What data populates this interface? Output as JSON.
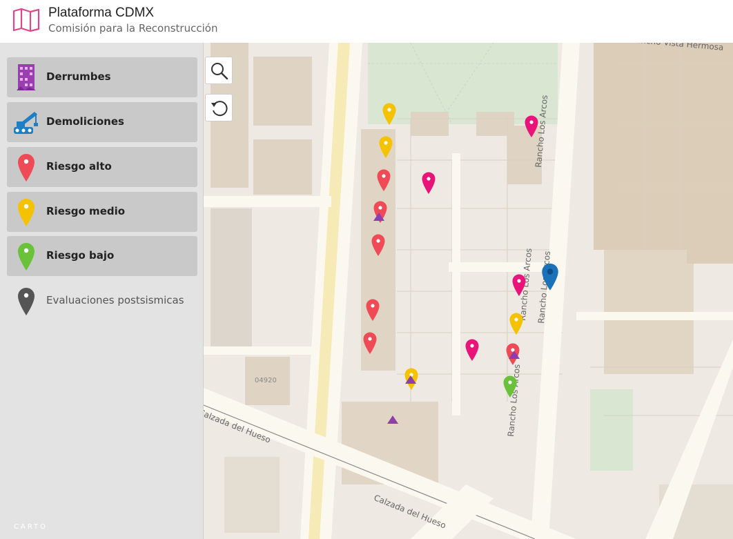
{
  "header": {
    "title": "Plataforma CDMX",
    "subtitle": "Comisión para la Reconstrucción",
    "logo_icon": "map-fold-icon",
    "logo_color": "#e0468a"
  },
  "legend": [
    {
      "key": "derrumbes",
      "label": "Derrumbes",
      "icon": "collapsed-building-icon",
      "color": "#9b3fb0",
      "active": true
    },
    {
      "key": "demoliciones",
      "label": "Demoliciones",
      "icon": "crane-icon",
      "color": "#1f7fc4",
      "active": true
    },
    {
      "key": "riesgo_alto",
      "label": "Riesgo alto",
      "icon": "map-pin-icon",
      "color": "#ef4b57",
      "active": true
    },
    {
      "key": "riesgo_medio",
      "label": "Riesgo medio",
      "icon": "map-pin-icon",
      "color": "#f5c200",
      "active": true
    },
    {
      "key": "riesgo_bajo",
      "label": "Riesgo bajo",
      "icon": "map-pin-icon",
      "color": "#6ac13a",
      "active": true
    },
    {
      "key": "evaluaciones",
      "label": "Evaluaciones postsismicas",
      "icon": "map-pin-icon",
      "color": "#555555",
      "active": false
    }
  ],
  "controls": {
    "search_icon": "search-icon",
    "reset_icon": "reset-view-icon"
  },
  "map": {
    "attribution": "CARTO",
    "postal_code": "04920",
    "streets": {
      "rancho_vista_hermosa": "Rancho Vista Hermosa",
      "rancho_los_arcos_top": "Rancho Los Arcos",
      "rancho_los_arcos_mid_a": "Rancho Los Arcos",
      "rancho_los_arcos_mid_b": "Rancho Los Arcos",
      "rancho_los_arcos_bottom": "Rancho Los Arcos",
      "calzada_hueso_left": "Calzada del Hueso",
      "calzada_hueso_bottom": "Calzada del Hueso"
    },
    "marker_colors": {
      "red": "#ef4b57",
      "magenta": "#e8147a",
      "yellow": "#f5c200",
      "green": "#6ac13a",
      "blue": "#1a73b8",
      "purple": "#8e3fae"
    }
  }
}
